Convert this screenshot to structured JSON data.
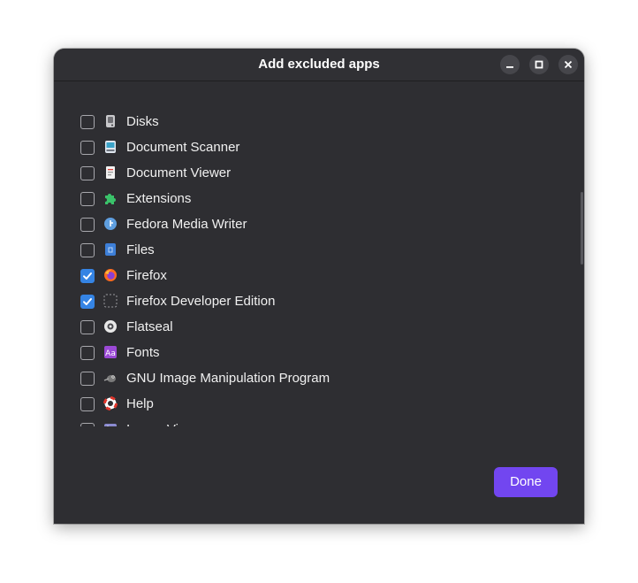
{
  "window": {
    "title": "Add excluded apps",
    "controls": [
      "minimize-icon",
      "maximize-icon",
      "close-icon"
    ]
  },
  "apps": [
    {
      "label": "Disks",
      "checked": false,
      "icon": "disks-icon"
    },
    {
      "label": "Document Scanner",
      "checked": false,
      "icon": "document-scanner-icon"
    },
    {
      "label": "Document Viewer",
      "checked": false,
      "icon": "document-viewer-icon"
    },
    {
      "label": "Extensions",
      "checked": false,
      "icon": "puzzle-icon"
    },
    {
      "label": "Fedora Media Writer",
      "checked": false,
      "icon": "fedora-icon"
    },
    {
      "label": "Files",
      "checked": false,
      "icon": "files-icon"
    },
    {
      "label": "Firefox",
      "checked": true,
      "icon": "firefox-icon"
    },
    {
      "label": "Firefox Developer Edition",
      "checked": true,
      "icon": "placeholder-icon"
    },
    {
      "label": "Flatseal",
      "checked": false,
      "icon": "flatseal-icon"
    },
    {
      "label": "Fonts",
      "checked": false,
      "icon": "fonts-icon"
    },
    {
      "label": "GNU Image Manipulation Program",
      "checked": false,
      "icon": "gimp-icon"
    },
    {
      "label": "Help",
      "checked": false,
      "icon": "lifebuoy-icon"
    },
    {
      "label": "Image Viewer",
      "checked": false,
      "icon": "image-viewer-icon"
    }
  ],
  "footer": {
    "done_label": "Done"
  },
  "colors": {
    "accent": "#7246f0",
    "checkbox_checked": "#3584e4",
    "background": "#2e2e32"
  }
}
